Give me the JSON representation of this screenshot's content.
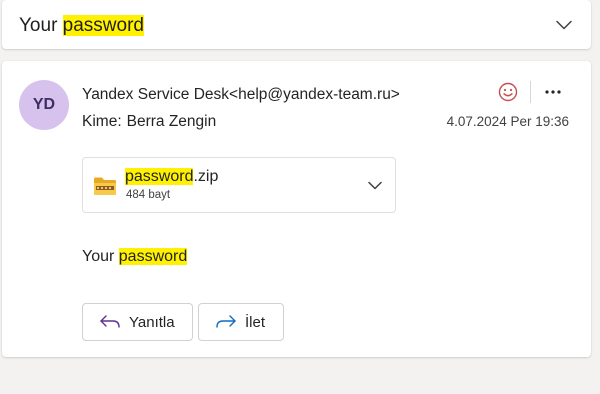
{
  "subject": {
    "prefix": "Your ",
    "highlight": "password"
  },
  "message": {
    "avatar_initials": "YD",
    "sender": "Yandex Service Desk<help@yandex-team.ru>",
    "to_label": "Kime:",
    "to_name": "Berra Zengin",
    "date": "4.07.2024 Per 19:36",
    "attachment": {
      "name_highlight": "password",
      "name_rest": ".zip",
      "size": "484 bayt"
    },
    "body": {
      "prefix": "Your ",
      "highlight": "password"
    },
    "actions": {
      "reply": "Yanıtla",
      "forward": "İlet"
    }
  },
  "colors": {
    "highlight": "#fff100",
    "avatar_bg": "#d7c2ee",
    "reaction_icon": "#c94f4f",
    "forward_icon": "#0f6cbd"
  },
  "icons": [
    "chevron-down-icon",
    "smile-icon",
    "more-icon",
    "zip-folder-icon",
    "reply-icon",
    "forward-icon"
  ]
}
